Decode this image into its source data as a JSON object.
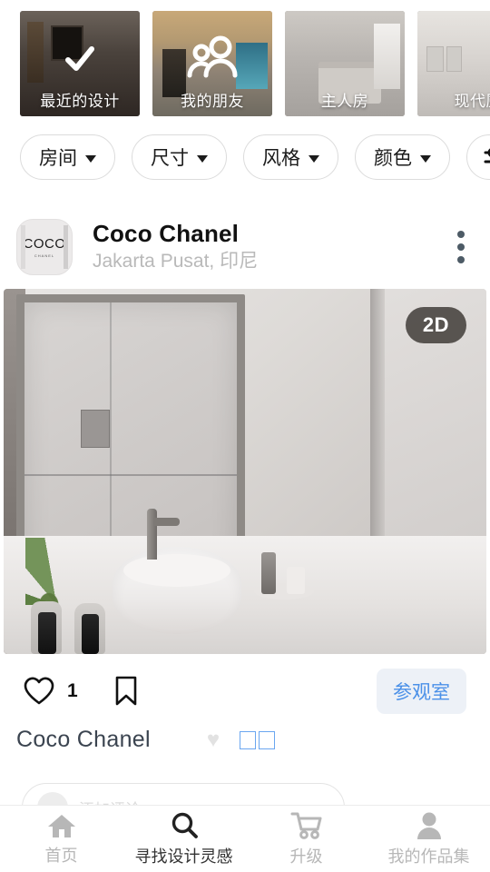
{
  "carousel": {
    "cards": [
      {
        "label": "最近的设计",
        "overlay_icon": "check-icon"
      },
      {
        "label": "我的朋友",
        "overlay_icon": "friends-icon"
      },
      {
        "label": "主人房",
        "overlay_icon": ""
      },
      {
        "label": "现代厨",
        "overlay_icon": ""
      }
    ]
  },
  "filters": {
    "chips": [
      {
        "label": "房间"
      },
      {
        "label": "尺寸"
      },
      {
        "label": "风格"
      },
      {
        "label": "颜色"
      }
    ],
    "settings_icon": "sliders-icon"
  },
  "post": {
    "avatar": {
      "brand": "COCO",
      "sub": "CHANEL"
    },
    "username": "Coco Chanel",
    "location": "Jakarta Pusat, 印尼",
    "menu_icon": "kebab-menu-icon",
    "image_badge": "2D",
    "actions": {
      "like_icon": "heart-icon",
      "like_count": "1",
      "bookmark_icon": "bookmark-icon",
      "visit_label": "参观室"
    },
    "caption": {
      "author": "Coco Chanel",
      "heart_emoji": "♥",
      "unsupported_glyphs": 2
    },
    "comment": {
      "placeholder": "添加评论…"
    }
  },
  "bottom_nav": {
    "items": [
      {
        "label": "首页",
        "icon": "home-icon",
        "active": false
      },
      {
        "label": "寻找设计灵感",
        "icon": "search-icon",
        "active": true
      },
      {
        "label": "升级",
        "icon": "cart-icon",
        "active": false
      },
      {
        "label": "我的作品集",
        "icon": "person-icon",
        "active": false
      }
    ]
  },
  "colors": {
    "accent_blue": "#4a90e8",
    "accent_blue_bg": "#edf1f7",
    "active_nav": "#333333",
    "inactive_nav": "#b7b7b7",
    "badge_bg": "#3a3632"
  }
}
